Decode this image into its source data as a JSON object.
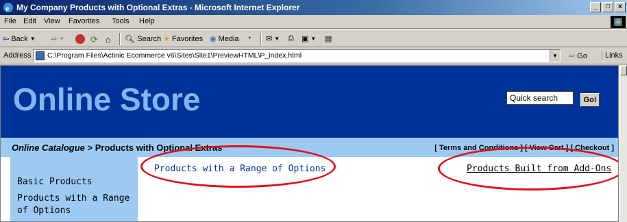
{
  "window": {
    "title": "My Company Products with Optional Extras - Microsoft Internet Explorer",
    "controls": {
      "minimize": "_",
      "maximize": "□",
      "close": "x"
    }
  },
  "menu": [
    "File",
    "Edit",
    "View",
    "Favorites",
    "Tools",
    "Help"
  ],
  "toolbar": {
    "back": "Back",
    "search": "Search",
    "favorites": "Favorites",
    "media": "Media"
  },
  "address": {
    "label": "Address",
    "url": "C:\\Program Files\\Actinic Ecommerce v6\\Sites\\Site1\\PreviewHTML\\P_index.html",
    "go": "Go",
    "links": "Links"
  },
  "page": {
    "store_title": "Online Store",
    "quick_search_value": "Quick search",
    "quick_search_button": "Go!",
    "breadcrumb_root": "Online Catalogue",
    "breadcrumb_sep": " > ",
    "breadcrumb_current": "Products with Optional Extras",
    "top_links": "[ Terms and Conditions ] [ View Cart ] [ Checkout ]",
    "sidebar": [
      "Basic Products",
      "Products with a Range",
      "of Options"
    ],
    "section_links": [
      "Products with a Range of Options",
      "Products Built from Add-Ons"
    ]
  },
  "colors": {
    "header_bg": "#003399",
    "header_title": "#7fb8f0",
    "crumb_bg": "#9ccaf2",
    "annotation": "#e0101a"
  }
}
